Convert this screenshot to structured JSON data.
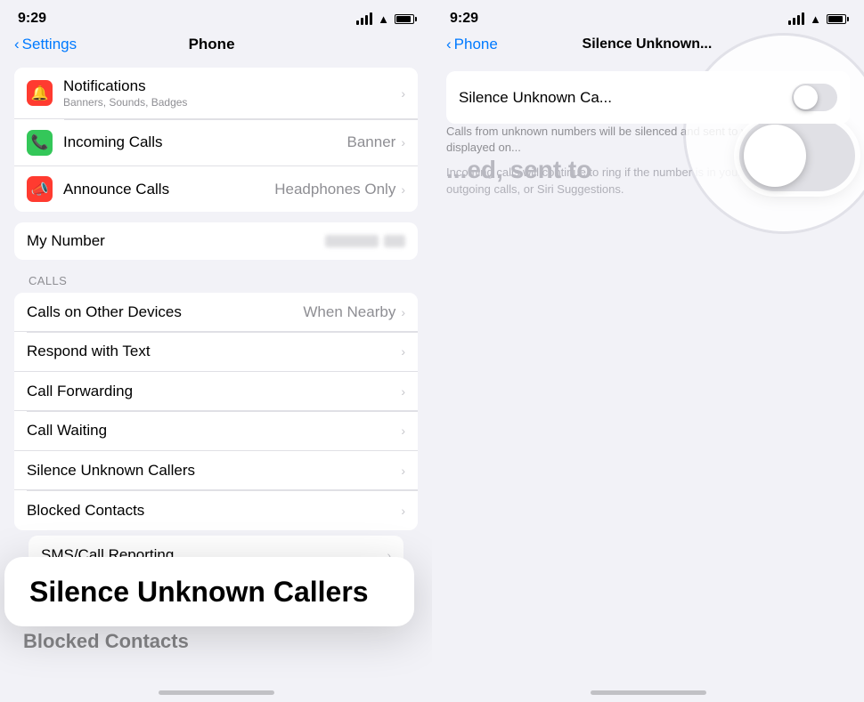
{
  "left_screen": {
    "status": {
      "time": "9:29"
    },
    "nav": {
      "back_label": "Settings",
      "title": "Phone"
    },
    "notifications_item": {
      "label": "Notifications",
      "sublabel": "Banners, Sounds, Badges"
    },
    "incoming_calls_item": {
      "label": "Incoming Calls",
      "value": "Banner"
    },
    "announce_calls_item": {
      "label": "Announce Calls",
      "value": "Headphones Only"
    },
    "my_number": {
      "section_label": "My Number"
    },
    "calls_section": {
      "header": "CALLS",
      "items": [
        {
          "label": "Calls on Other Devices",
          "value": "When Nearby"
        },
        {
          "label": "Respond with Text",
          "value": ""
        },
        {
          "label": "Call Forwarding",
          "value": ""
        },
        {
          "label": "Call Waiting",
          "value": ""
        },
        {
          "label": "Silence Unknown Callers",
          "value": ""
        },
        {
          "label": "Blocked Contacts",
          "value": ""
        }
      ]
    },
    "bottom_item": {
      "label": "SMS/Call Reporting"
    },
    "silence_bubble": {
      "text": "Silence Unknown Callers"
    },
    "blocked_partial": {
      "text": "Blocked Contacts"
    }
  },
  "right_screen": {
    "status": {
      "time": "9:29"
    },
    "nav": {
      "back_label": "Phone",
      "title": "Silence Unknown..."
    },
    "setting_row": {
      "label": "Silence Unknown Ca..."
    },
    "desc1": "Calls from unknown numbers will be silenced and sent to voicemail, and displayed on...",
    "desc2": "Incoming calls will continue to ring if the number is in your contacts, recent outgoing calls, or Siri Suggestions.",
    "big_text": "...ed, sent to"
  },
  "icons": {
    "bell": "🔔",
    "phone_green": "📞",
    "phone_orange": "📣",
    "chevron": "›",
    "back_chevron": "‹"
  }
}
